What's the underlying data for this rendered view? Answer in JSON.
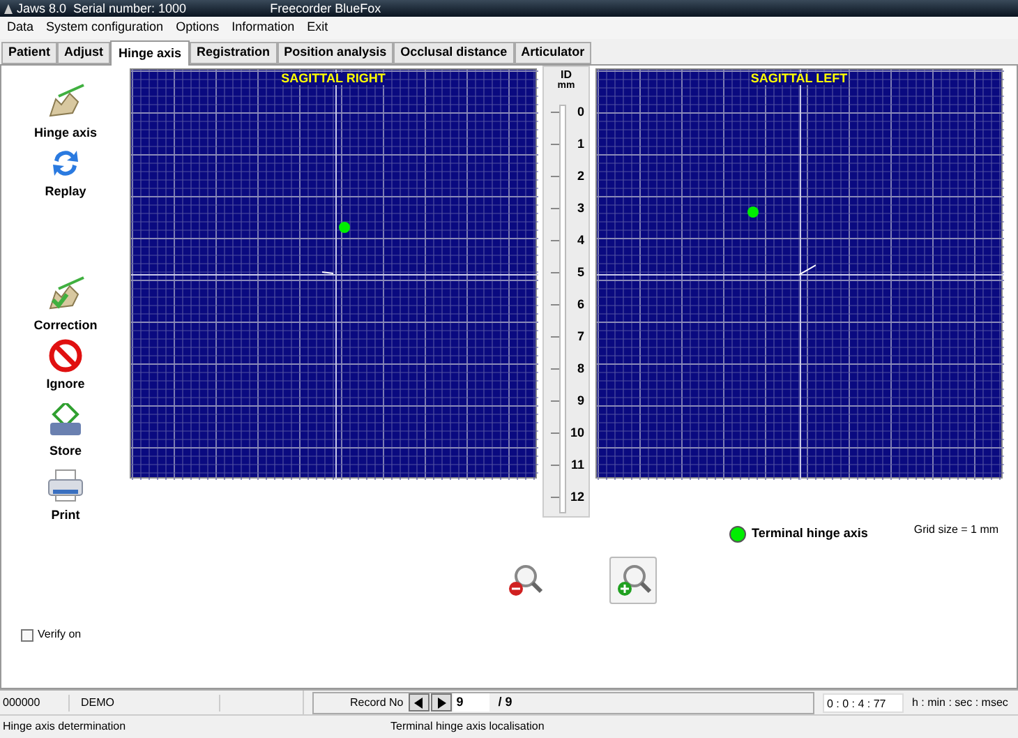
{
  "window": {
    "title": "Jaws 8.0  Serial number: 1000",
    "subtitle": "Freecorder BlueFox"
  },
  "menu": [
    "Data",
    "System configuration",
    "Options",
    "Information",
    "Exit"
  ],
  "tabs": [
    {
      "label": "Patient",
      "selected": false
    },
    {
      "label": "Adjust",
      "selected": false
    },
    {
      "label": "Hinge axis",
      "selected": true
    },
    {
      "label": "Registration",
      "selected": false
    },
    {
      "label": "Position analysis",
      "selected": false
    },
    {
      "label": "Occlusal distance",
      "selected": false
    },
    {
      "label": "Articulator",
      "selected": false
    }
  ],
  "tools": [
    {
      "label": "Hinge axis",
      "kind": "jaw"
    },
    {
      "label": "Replay",
      "kind": "replay"
    },
    {
      "label": "Correction",
      "kind": "correction"
    },
    {
      "label": "Ignore",
      "kind": "ignore"
    },
    {
      "label": "Store",
      "kind": "store"
    },
    {
      "label": "Print",
      "kind": "print"
    }
  ],
  "plots": [
    {
      "title": "SAGITTAL RIGHT"
    },
    {
      "title": "SAGITTAL LEFT"
    }
  ],
  "scale": {
    "title": "ID",
    "unit": "mm",
    "ticks": [
      "0",
      "1",
      "2",
      "3",
      "4",
      "5",
      "6",
      "7",
      "8",
      "9",
      "10",
      "11",
      "12"
    ]
  },
  "legend": {
    "label": "Terminal hinge axis",
    "color": "#00ee00"
  },
  "grid_note": "Grid size = 1 mm",
  "verify": {
    "label": "Verify on",
    "checked": false
  },
  "status": {
    "code": "000000",
    "user": "DEMO",
    "record_label": "Record No",
    "record": "9",
    "total": "/ 9",
    "time": "0 : 0 : 4 : 77",
    "time_format": "h : min : sec : msec"
  },
  "status2": [
    "Hinge axis determination",
    "Terminal hinge axis localisation"
  ]
}
